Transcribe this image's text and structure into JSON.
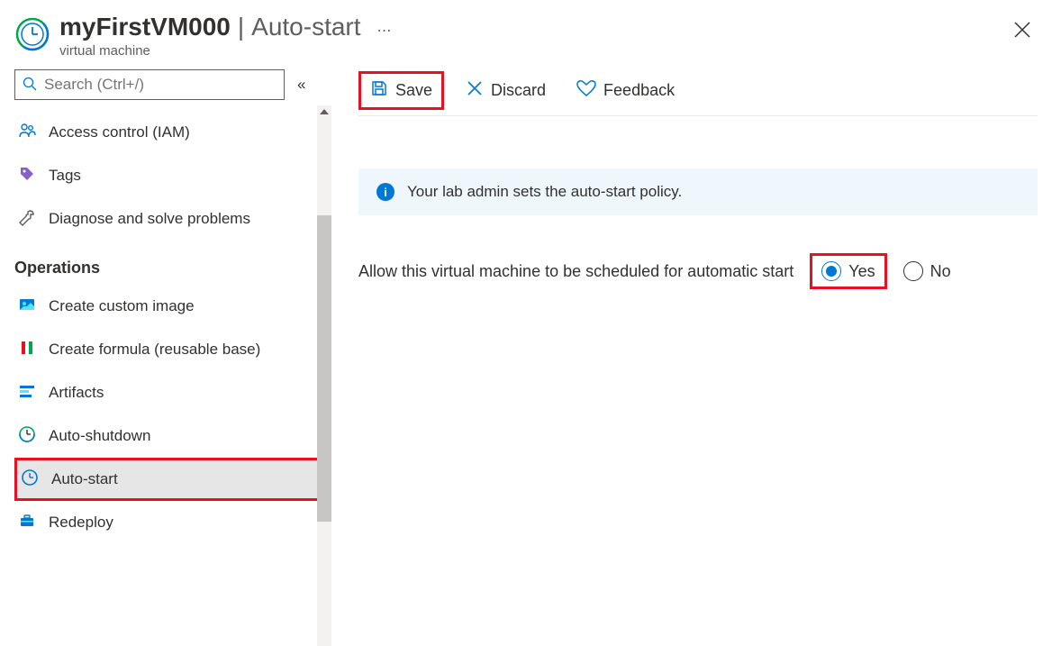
{
  "header": {
    "resource_name": "myFirstVM000",
    "page_name": "Auto-start",
    "subtitle": "virtual machine"
  },
  "sidebar": {
    "search_placeholder": "Search (Ctrl+/)",
    "items_top": [
      {
        "label": "Access control (IAM)"
      },
      {
        "label": "Tags"
      },
      {
        "label": "Diagnose and solve problems"
      }
    ],
    "section_label": "Operations",
    "items_ops": [
      {
        "label": "Create custom image"
      },
      {
        "label": "Create formula (reusable base)"
      },
      {
        "label": "Artifacts"
      },
      {
        "label": "Auto-shutdown"
      },
      {
        "label": "Auto-start"
      },
      {
        "label": "Redeploy"
      }
    ]
  },
  "toolbar": {
    "save_label": "Save",
    "discard_label": "Discard",
    "feedback_label": "Feedback"
  },
  "infobox": {
    "message": "Your lab admin sets the auto-start policy."
  },
  "option": {
    "label": "Allow this virtual machine to be scheduled for automatic start",
    "yes_label": "Yes",
    "no_label": "No",
    "value": "yes"
  }
}
